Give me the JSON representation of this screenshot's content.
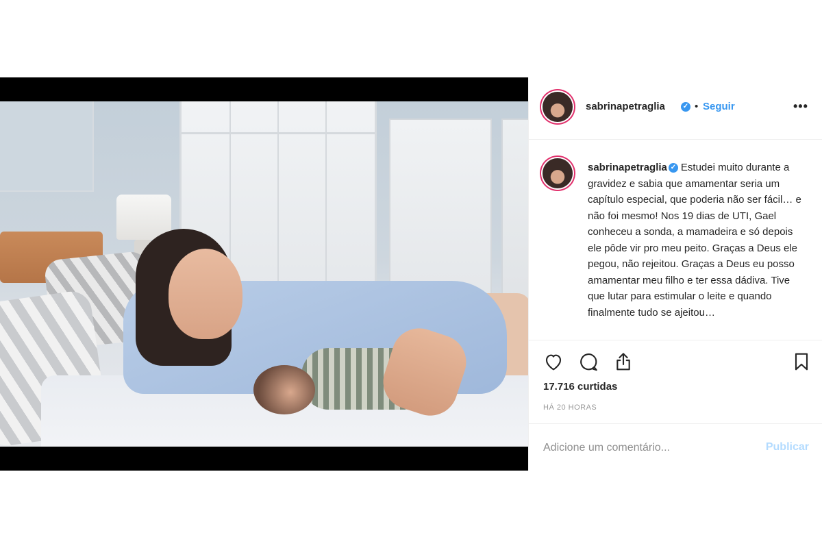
{
  "post": {
    "username": "sabrinapetraglia",
    "verified_glyph": "✓",
    "separator": "•",
    "follow_label": "Seguir",
    "more_icon": "more-horizontal-icon",
    "more_glyph": "•••"
  },
  "caption": {
    "username": "sabrinapetraglia",
    "text": "Estudei muito durante a gravidez e sabia que amamentar seria um capítulo especial, que poderia não ser fácil… e não foi mesmo! Nos 19 dias de UTI, Gael conheceu a sonda, a mamadeira e só depois ele pôde vir pro meu peito. Graças a Deus ele pegou, não rejeitou. Graças a Deus eu posso amamentar meu filho e ter essa dádiva. Tive que lutar para estimular o leite e quando finalmente tudo se ajeitou…"
  },
  "actions": {
    "like_icon": "heart-icon",
    "comment_icon": "comment-icon",
    "share_icon": "share-icon",
    "save_icon": "bookmark-icon"
  },
  "stats": {
    "likes": "17.716 curtidas",
    "time": "HÁ 20 HORAS"
  },
  "comment": {
    "placeholder": "Adicione um comentário...",
    "publish_label": "Publicar"
  },
  "colors": {
    "link": "#3897f0",
    "publish_disabled": "#b3dbff",
    "story_ring": "#e1306c"
  }
}
